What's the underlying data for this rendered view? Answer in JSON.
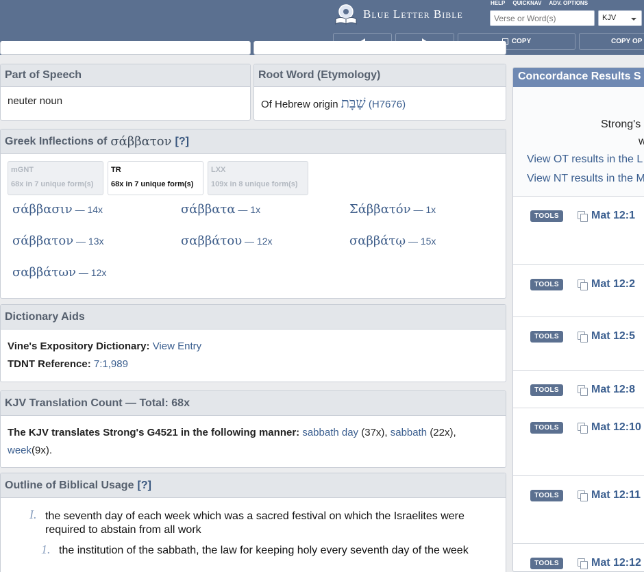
{
  "header": {
    "logo_text": "Blue Letter Bible",
    "links": [
      "HELP",
      "QUICKNAV",
      "ADV. OPTIONS"
    ],
    "search_placeholder": "Verse or Word(s)",
    "version": "KJV",
    "copy_label": "COPY",
    "copy_options_label": "COPY OP"
  },
  "part_of_speech": {
    "title": "Part of Speech",
    "value": "neuter noun"
  },
  "root_word": {
    "title": "Root Word (Etymology)",
    "prefix": "Of Hebrew origin",
    "hebrew": "שַׁבָּת",
    "ref": "(H7676)"
  },
  "inflections": {
    "title_prefix": "Greek Inflections of",
    "lemma": "σάββατον",
    "help": "[?]",
    "tabs": [
      {
        "name": "mGNT",
        "detail": "68x in 7 unique form(s)"
      },
      {
        "name": "TR",
        "detail": "68x in 7 unique form(s)"
      },
      {
        "name": "LXX",
        "detail": "109x in 8 unique form(s)"
      }
    ],
    "forms": [
      {
        "word": "σάββασιν",
        "count": "— 14x"
      },
      {
        "word": "σάββατα",
        "count": "— 1x"
      },
      {
        "word": "Σάββατόν",
        "count": "— 1x"
      },
      {
        "word": "σάββατον",
        "count": "— 13x"
      },
      {
        "word": "σαββάτου",
        "count": "— 12x"
      },
      {
        "word": "σαββάτῳ",
        "count": "— 15x"
      },
      {
        "word": "σαββάτων",
        "count": "— 12x"
      }
    ]
  },
  "dictionary": {
    "title": "Dictionary Aids",
    "vines_label": "Vine's Expository Dictionary:",
    "vines_link": "View Entry",
    "tdnt_label": "TDNT Reference:",
    "tdnt_link": "7:1,989"
  },
  "translation": {
    "title": "KJV Translation Count — Total: 68x",
    "lead": "The KJV translates Strong's G4521 in the following manner:",
    "t1": "sabbath day",
    "c1": "(37x),",
    "t2": "sabbath",
    "c2": "(22x),",
    "t3": "week",
    "c3": "(9x)."
  },
  "outline": {
    "title": "Outline of Biblical Usage",
    "help": "[?]",
    "items": [
      {
        "marker": "I.",
        "text": "the seventh day of each week which was a sacred festival on which the Israelites were required to abstain from all work"
      },
      {
        "marker": "1.",
        "text": "the institution of the sabbath, the law for keeping holy every seventh day of the week"
      }
    ]
  },
  "concordance": {
    "title": "Concordance Results S",
    "strongs_text": "Strong's",
    "w_text": "w",
    "ot_link": "View OT results in the L",
    "nt_link": "View NT results in the M",
    "tools_label": "TOOLS",
    "verses": [
      "Mat 12:1",
      "Mat 12:2",
      "Mat 12:5",
      "Mat 12:8",
      "Mat 12:10",
      "Mat 12:11",
      "Mat 12:12"
    ]
  }
}
